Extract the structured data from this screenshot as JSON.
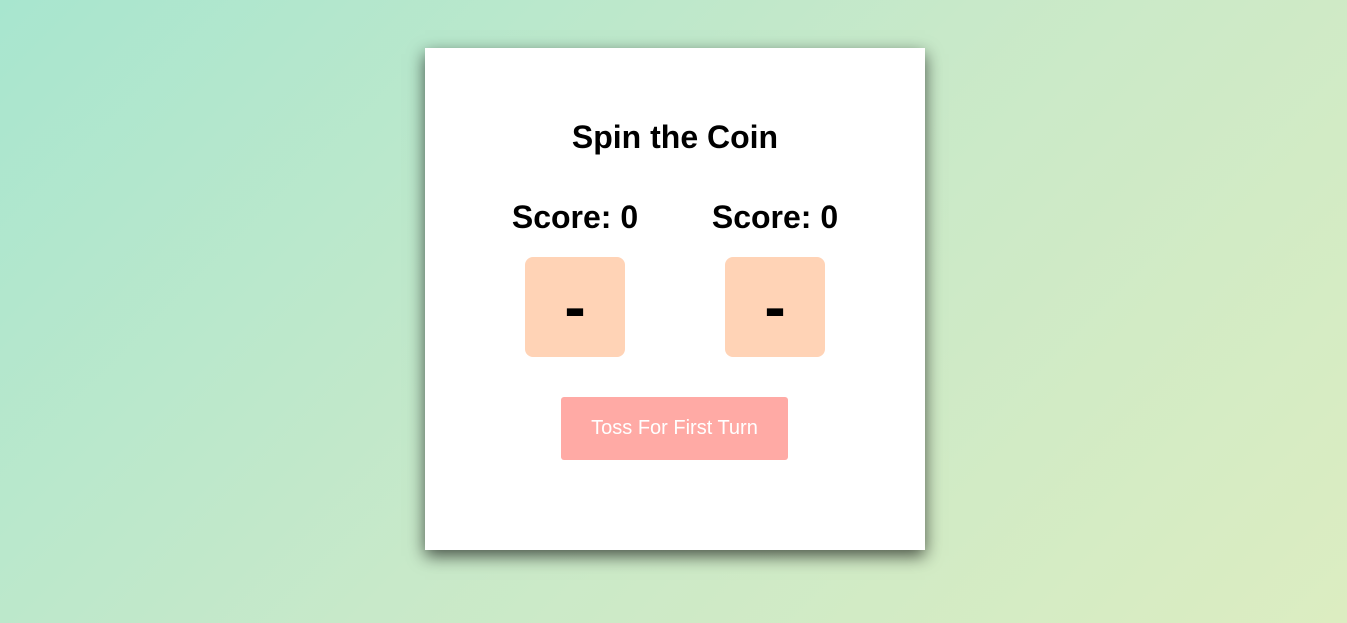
{
  "game": {
    "title": "Spin the Coin",
    "players": [
      {
        "score_label": "Score: 0",
        "coin_face": "-"
      },
      {
        "score_label": "Score: 0",
        "coin_face": "-"
      }
    ],
    "toss_button_label": "Toss For First Turn"
  },
  "colors": {
    "coin_box": "#ffd3b6",
    "toss_button": "#ffaaa5",
    "card": "#ffffff"
  }
}
